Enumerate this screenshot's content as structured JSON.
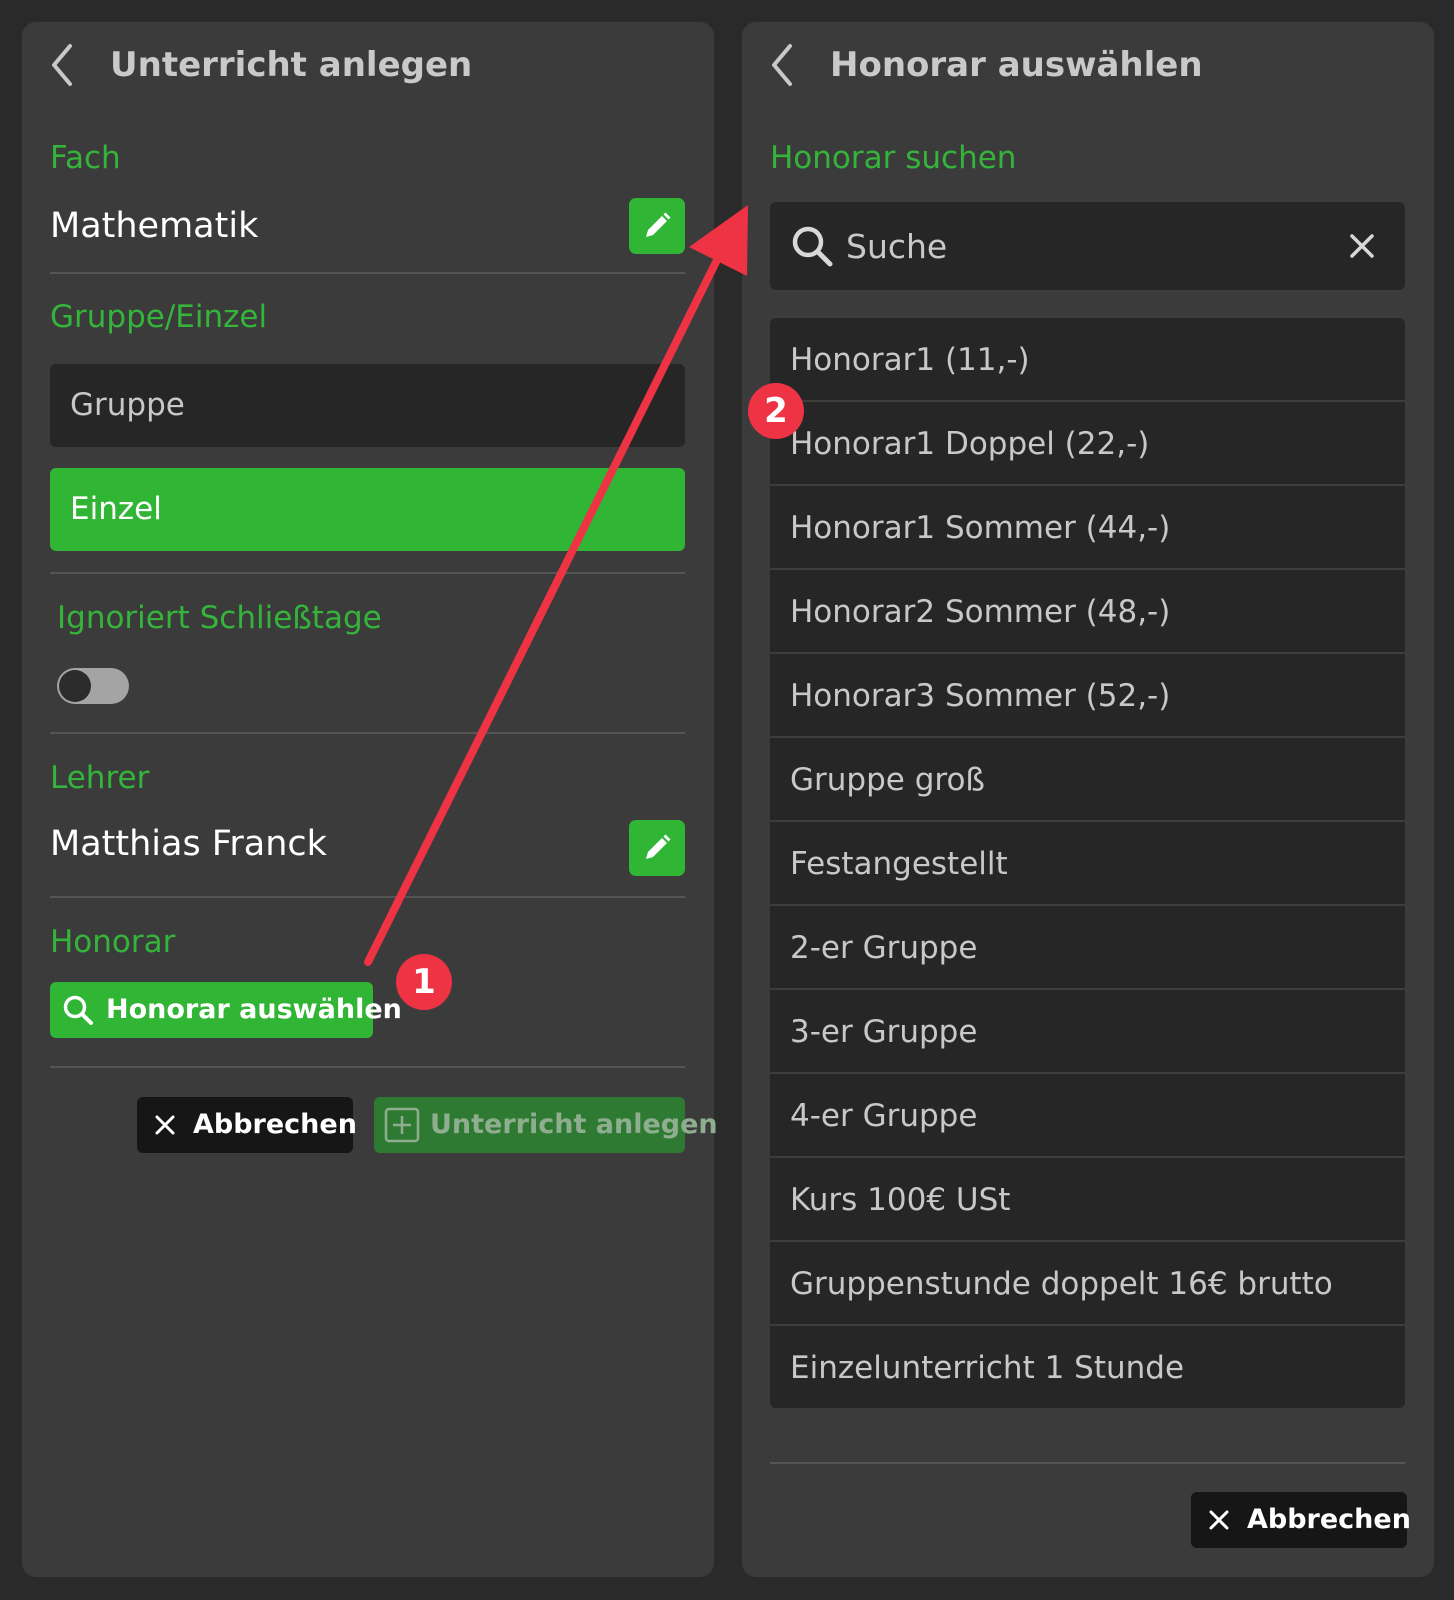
{
  "left_panel": {
    "title": "Unterricht anlegen",
    "fach": {
      "label": "Fach",
      "value": "Mathematik"
    },
    "gruppe_einzel": {
      "label": "Gruppe/Einzel",
      "options": [
        "Gruppe",
        "Einzel"
      ],
      "selected": "Einzel"
    },
    "schliesstage": {
      "label": "Ignoriert Schließtage",
      "enabled": false
    },
    "lehrer": {
      "label": "Lehrer",
      "value": "Matthias Franck"
    },
    "honorar": {
      "label": "Honorar",
      "button_label": "Honorar auswählen"
    },
    "actions": {
      "cancel_label": "Abbrechen",
      "create_label": "Unterricht anlegen"
    }
  },
  "right_panel": {
    "title": "Honorar auswählen",
    "search_label": "Honorar suchen",
    "search_placeholder": "Suche",
    "items": [
      "Honorar1 (11,-)",
      "Honorar1 Doppel (22,-)",
      "Honorar1 Sommer (44,-)",
      "Honorar2 Sommer (48,-)",
      "Honorar3 Sommer (52,-)",
      "Gruppe groß",
      "Festangestellt",
      "2-er Gruppe",
      "3-er Gruppe",
      "4-er Gruppe",
      "Kurs 100€ USt",
      "Gruppenstunde doppelt 16€ brutto",
      "Einzelunterricht 1 Stunde"
    ],
    "cancel_label": "Abbrechen"
  },
  "annotations": {
    "badge_1": "1",
    "badge_2": "2"
  },
  "colors": {
    "accent_green": "#31b535",
    "label_green": "#34b43a",
    "annotation_red": "#ee3344",
    "panel_bg": "#3b3b3b"
  },
  "icons": [
    "chevron-left-icon",
    "pencil-icon",
    "search-icon",
    "close-icon",
    "plus-square-icon"
  ]
}
